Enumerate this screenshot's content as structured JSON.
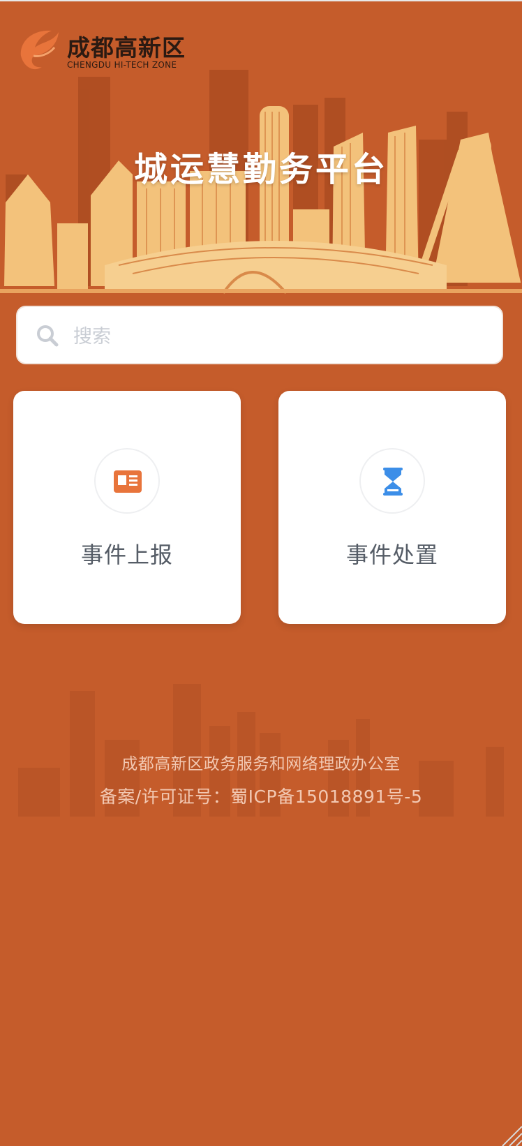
{
  "header": {
    "logo_cn": "成都高新区",
    "logo_en": "CHENGDU HI-TECH ZONE",
    "title": "城运慧勤务平台"
  },
  "search": {
    "placeholder": "搜索",
    "icon": "search-icon"
  },
  "cards": [
    {
      "label": "事件上报",
      "icon": "report-card-icon",
      "icon_color": "#e8743b"
    },
    {
      "label": "事件处置",
      "icon": "hourglass-icon",
      "icon_color": "#3c8ee8"
    }
  ],
  "footer": {
    "org": "成都高新区政务服务和网络理政办公室",
    "license": "备案/许可证号：蜀ICP备15018891号-5"
  },
  "colors": {
    "background": "#c55c2b",
    "skyline_light": "#f3c27b",
    "card_bg": "#ffffff"
  }
}
